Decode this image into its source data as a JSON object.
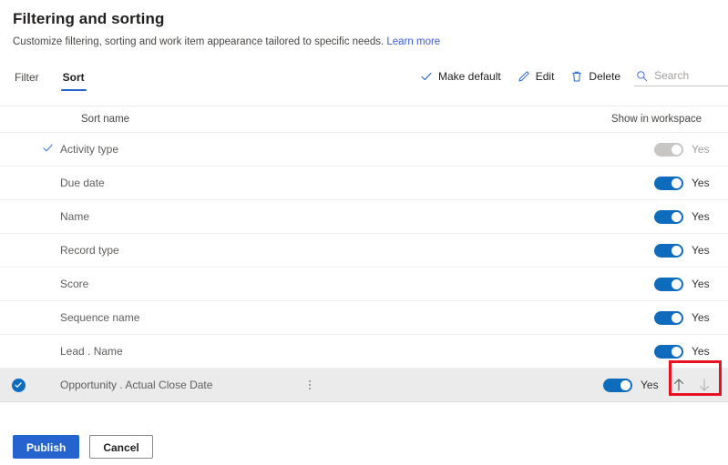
{
  "header": {
    "title": "Filtering and sorting",
    "subtitle": "Customize filtering, sorting and work item appearance tailored to specific needs.",
    "learn_more": "Learn more"
  },
  "tabs": [
    {
      "label": "Filter",
      "active": false
    },
    {
      "label": "Sort",
      "active": true
    }
  ],
  "toolbar": {
    "make_default_label": "Make default",
    "edit_label": "Edit",
    "delete_label": "Delete",
    "search_placeholder": "Search",
    "search_value": ""
  },
  "table": {
    "columns": {
      "sort_name": "Sort name",
      "show_in_workspace": "Show in workspace"
    },
    "rows": [
      {
        "name": "Activity type",
        "is_default": true,
        "selected": false,
        "toggle_on": true,
        "toggle_disabled": true,
        "toggle_label": "Yes"
      },
      {
        "name": "Due date",
        "is_default": false,
        "selected": false,
        "toggle_on": true,
        "toggle_disabled": false,
        "toggle_label": "Yes"
      },
      {
        "name": "Name",
        "is_default": false,
        "selected": false,
        "toggle_on": true,
        "toggle_disabled": false,
        "toggle_label": "Yes"
      },
      {
        "name": "Record type",
        "is_default": false,
        "selected": false,
        "toggle_on": true,
        "toggle_disabled": false,
        "toggle_label": "Yes"
      },
      {
        "name": "Score",
        "is_default": false,
        "selected": false,
        "toggle_on": true,
        "toggle_disabled": false,
        "toggle_label": "Yes"
      },
      {
        "name": "Sequence name",
        "is_default": false,
        "selected": false,
        "toggle_on": true,
        "toggle_disabled": false,
        "toggle_label": "Yes"
      },
      {
        "name": "Lead . Name",
        "is_default": false,
        "selected": false,
        "toggle_on": true,
        "toggle_disabled": false,
        "toggle_label": "Yes"
      },
      {
        "name": "Opportunity . Actual Close Date",
        "is_default": false,
        "selected": true,
        "toggle_on": true,
        "toggle_disabled": false,
        "toggle_label": "Yes",
        "show_more": true,
        "show_arrows": true
      }
    ]
  },
  "footer": {
    "publish_label": "Publish",
    "cancel_label": "Cancel"
  },
  "colors": {
    "accent_blue": "#2564cf",
    "toggle_blue": "#0f6cbd",
    "link_blue": "#3b5bdb",
    "annotation_red": "#e81123",
    "selected_row": "#ebebeb",
    "disabled_grey": "#c8c6c4"
  },
  "icons": {
    "make_default": "checkmark-icon",
    "edit": "pencil-icon",
    "delete": "trash-icon",
    "search": "search-icon",
    "default_row": "checkmark-icon",
    "selected_row": "check-circle-icon",
    "row_menu": "more-vertical-icon",
    "move_up": "arrow-up-icon",
    "move_down": "arrow-down-icon"
  }
}
